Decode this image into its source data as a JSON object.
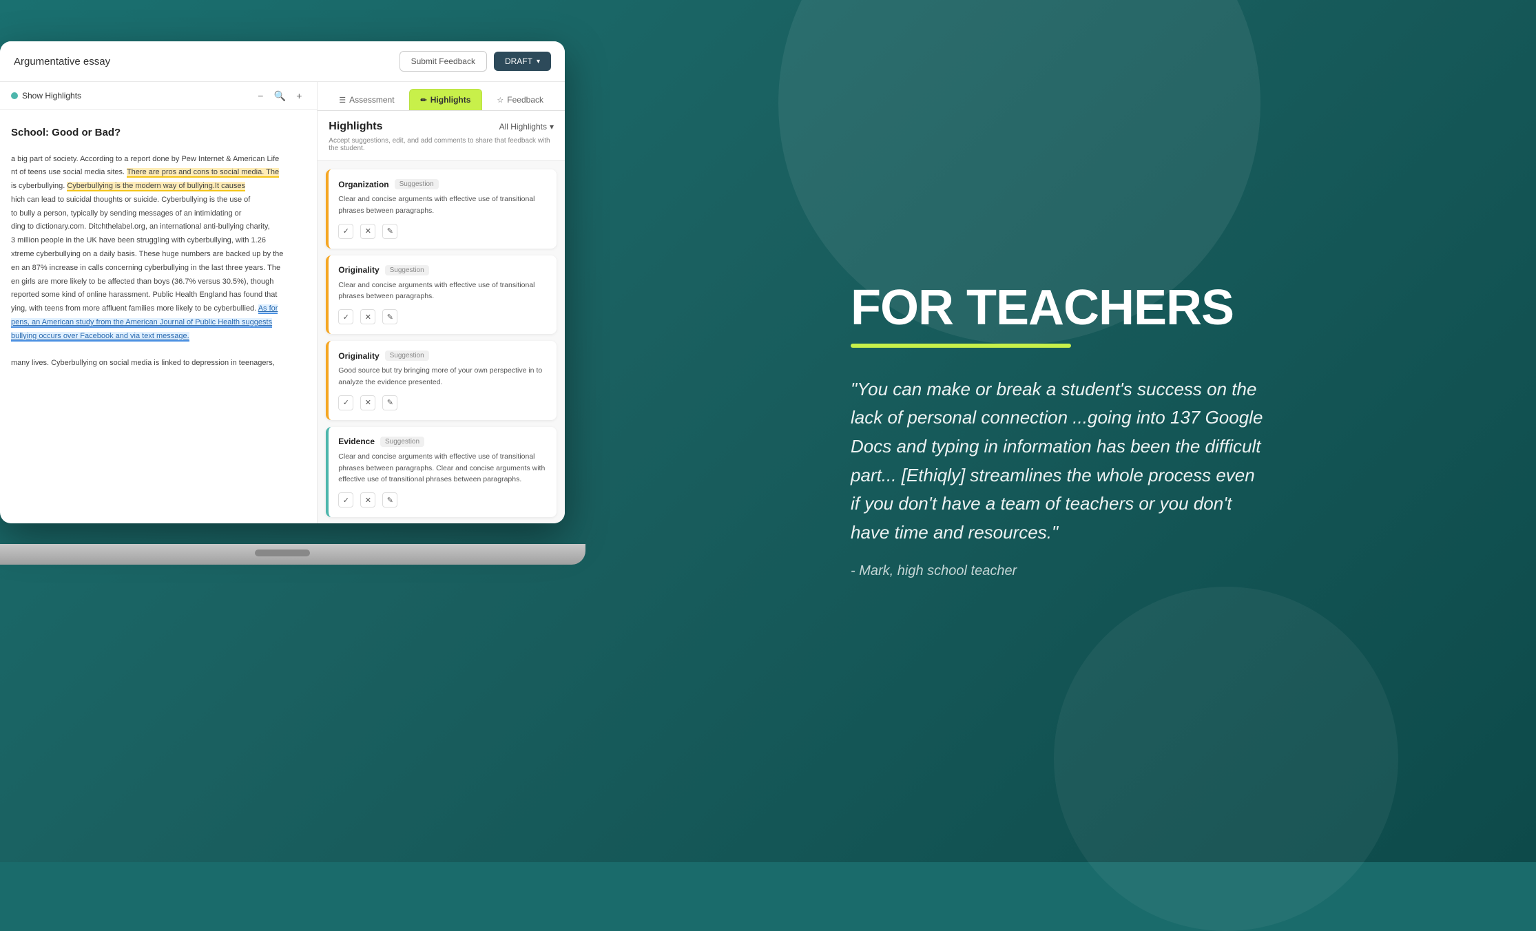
{
  "background": {
    "color": "#1a6b6b"
  },
  "header": {
    "title": "Argumentative essay",
    "submit_feedback_label": "Submit Feedback",
    "draft_label": "DRAFT",
    "draft_icon": "▾"
  },
  "essay_panel": {
    "show_highlights_label": "Show Highlights",
    "toolbar": {
      "minus": "−",
      "search": "🔍",
      "plus": "+"
    },
    "title": "School: Good or Bad?",
    "paragraphs": [
      "a big part of society. According to a report done by Pew Internet & American Life",
      "nt of teens use social media sites. There are pros and cons to social media. The",
      "is cyberbullying. Cyberbullying is the modern way of bullying.It causes",
      "hich can lead to suicidal thoughts or suicide. Cyberbullying is the use of",
      "to bully a person, typically by sending messages of an intimidating or",
      "ding to dictionary.com. Ditchthelabel.org, an international anti-bullying charity,",
      "3 million people in the UK have been struggling with cyberbullying, with 1.26",
      "xtreme cyberbullying on a daily basis. These huge numbers are backed up by the",
      "en an 87% increase in calls concerning cyberbullying in the last three years. The",
      "en girls are more likely to be affected than boys (36.7% versus 30.5%), though",
      "reported some kind of online harassment. Public Health England has found that",
      "ying, with teens from more affluent families more likely to be cyberbullied.",
      "pens, an American study from the American Journal of Public Health suggests",
      "bullying occurs over Facebook and via text message.",
      "",
      "many lives. Cyberbullying on social media is linked to depression in teenagers,"
    ]
  },
  "tabs": [
    {
      "id": "assessment",
      "label": "Assessment",
      "icon": "☰",
      "active": false
    },
    {
      "id": "highlights",
      "label": "Highlights",
      "icon": "✏",
      "active": true
    },
    {
      "id": "feedback",
      "label": "Feedback",
      "icon": "☆",
      "active": false
    }
  ],
  "highlights": {
    "title": "Highlights",
    "all_highlights_label": "All Highlights",
    "all_highlights_icon": "▾",
    "subtitle": "Accept suggestions, edit, and add comments to share that feedback with the student.",
    "cards": [
      {
        "id": "card-1",
        "category": "Organization",
        "badge": "Suggestion",
        "text": "Clear and concise arguments with effective use of transitional phrases between paragraphs.",
        "color": "orange",
        "actions": [
          "✓",
          "✕",
          "✎"
        ]
      },
      {
        "id": "card-2",
        "category": "Originality",
        "badge": "Suggestion",
        "text": "Clear and concise arguments with effective use of transitional phrases between paragraphs.",
        "color": "orange",
        "actions": [
          "✓",
          "✕",
          "✎"
        ]
      },
      {
        "id": "card-3",
        "category": "Originality",
        "badge": "Suggestion",
        "text": "Good source but try bringing more of your own perspective in to analyze the evidence presented.",
        "color": "orange",
        "actions": [
          "✓",
          "✕",
          "✎"
        ]
      },
      {
        "id": "card-4",
        "category": "Evidence",
        "badge": "Suggestion",
        "text": "Clear and concise arguments with effective use of transitional phrases between paragraphs. Clear and concise arguments with effective use of transitional phrases between paragraphs.",
        "color": "teal",
        "actions": [
          "✓",
          "✕",
          "✎"
        ]
      }
    ]
  },
  "marketing": {
    "heading": "FOR TEACHERS",
    "quote": "\"You can make or break a student's success on the lack of personal connection ...going into 137 Google Docs and typing in information has been the difficult part... [Ethiqly] streamlines the whole process even if you don't have a team of teachers or you don't have time and resources.\"",
    "author": "- Mark, high school teacher"
  }
}
